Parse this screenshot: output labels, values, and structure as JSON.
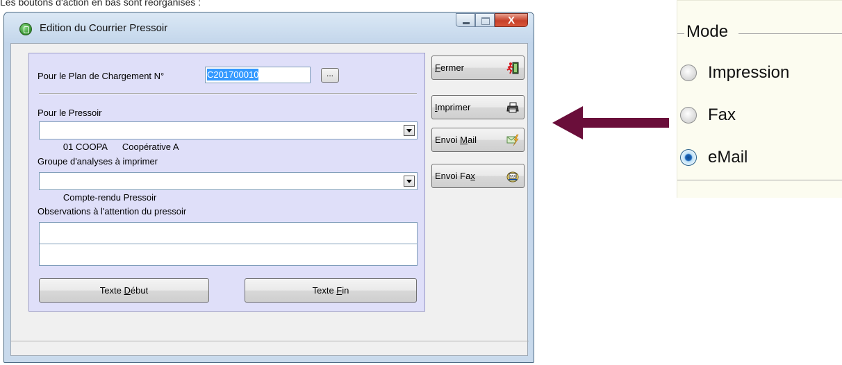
{
  "caption_fragment": "Les boutons d'action en bas sont réorganisés :",
  "window": {
    "title": "Edition du Courrier Pressoir",
    "close_glyph": "X"
  },
  "form": {
    "plan_label": "Pour le Plan de Chargement N°",
    "plan_value": "C201700010",
    "browse_label": "...",
    "pressoir_label": "Pour le Pressoir",
    "pressoir_value": "01 COOPA      Coopérative A",
    "groupe_label": "Groupe d'analyses à imprimer",
    "groupe_value": "Compte-rendu Pressoir",
    "obs_label": "Observations à l'attention du pressoir",
    "texte_debut": {
      "pre": "Texte ",
      "key": "D",
      "post": "ébut"
    },
    "texte_fin": {
      "pre": "Texte ",
      "key": "F",
      "post": "in"
    }
  },
  "side_buttons": {
    "fermer": {
      "pre": "",
      "key": "F",
      "post": "ermer",
      "icon": "exit-runner-icon"
    },
    "imprimer": {
      "pre": "",
      "key": "I",
      "post": "mprimer",
      "icon": "printer-icon"
    },
    "envoi_mail": {
      "pre": "Envoi ",
      "key": "M",
      "post": "ail",
      "icon": "email-send-icon"
    },
    "envoi_fax": {
      "pre": "Envoi Fa",
      "key": "x",
      "post": "",
      "icon": "fax-icon"
    }
  },
  "mode": {
    "legend": "Mode",
    "options": [
      "Impression",
      "Fax",
      "eMail"
    ],
    "selected": "eMail"
  },
  "colors": {
    "panel_bg": "#dfdff9",
    "arrow": "#6a0e3a",
    "selection": "#3399ff"
  }
}
